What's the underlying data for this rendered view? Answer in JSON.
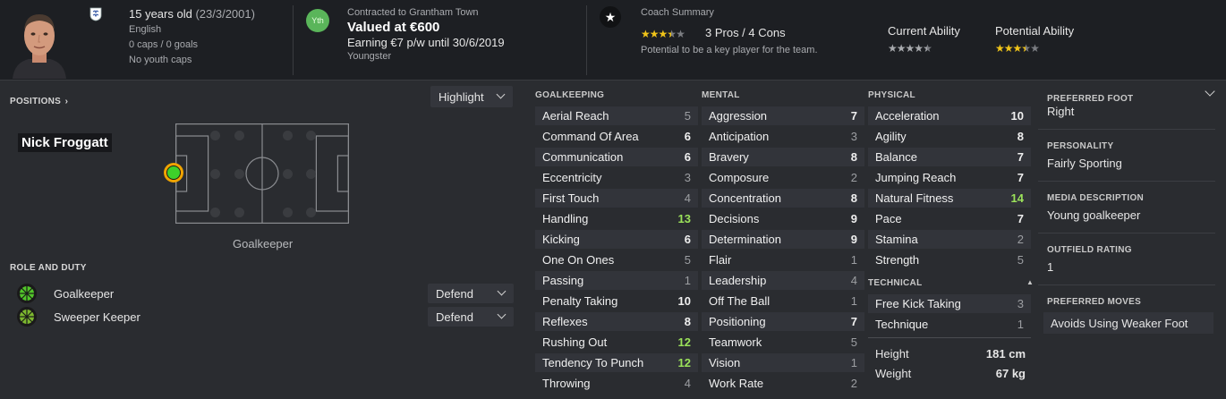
{
  "header": {
    "age": "15 years old",
    "dob": "(23/3/2001)",
    "nationality": "English",
    "caps": "0 caps / 0 goals",
    "youth_caps": "No youth caps",
    "status_badge": "Yth",
    "contract": "Contracted to Grantham Town",
    "value": "Valued at €600",
    "wage": "Earning €7 p/w until 30/6/2019",
    "status": "Youngster",
    "coach_title": "Coach Summary",
    "pros_cons": "3 Pros / 4 Cons",
    "coach_summary": "Potential to be a key player for the team.",
    "coach_stars": 3.5,
    "current_ability_label": "Current Ability",
    "current_ability_stars": 4.5,
    "potential_ability_label": "Potential Ability",
    "potential_ability_stars": 3.5
  },
  "positions": {
    "header": "POSITIONS",
    "highlight_label": "Highlight",
    "player_name": "Nick Froggatt",
    "position_label": "Goalkeeper"
  },
  "roles": {
    "header": "ROLE AND DUTY",
    "items": [
      {
        "name": "Goalkeeper",
        "duty": "Defend",
        "color": "#52c62a"
      },
      {
        "name": "Sweeper Keeper",
        "duty": "Defend",
        "color": "#7cb82f"
      }
    ]
  },
  "attributes": {
    "goalkeeping": {
      "header": "GOALKEEPING",
      "items": [
        {
          "name": "Aerial Reach",
          "value": "5"
        },
        {
          "name": "Command Of Area",
          "value": "6"
        },
        {
          "name": "Communication",
          "value": "6"
        },
        {
          "name": "Eccentricity",
          "value": "3"
        },
        {
          "name": "First Touch",
          "value": "4"
        },
        {
          "name": "Handling",
          "value": "13"
        },
        {
          "name": "Kicking",
          "value": "6"
        },
        {
          "name": "One On Ones",
          "value": "5"
        },
        {
          "name": "Passing",
          "value": "1"
        },
        {
          "name": "Penalty Taking",
          "value": "10"
        },
        {
          "name": "Reflexes",
          "value": "8"
        },
        {
          "name": "Rushing Out",
          "value": "12"
        },
        {
          "name": "Tendency To Punch",
          "value": "12"
        },
        {
          "name": "Throwing",
          "value": "4"
        }
      ]
    },
    "mental": {
      "header": "MENTAL",
      "items": [
        {
          "name": "Aggression",
          "value": "7"
        },
        {
          "name": "Anticipation",
          "value": "3"
        },
        {
          "name": "Bravery",
          "value": "8"
        },
        {
          "name": "Composure",
          "value": "2"
        },
        {
          "name": "Concentration",
          "value": "8"
        },
        {
          "name": "Decisions",
          "value": "9"
        },
        {
          "name": "Determination",
          "value": "9"
        },
        {
          "name": "Flair",
          "value": "1"
        },
        {
          "name": "Leadership",
          "value": "4"
        },
        {
          "name": "Off The Ball",
          "value": "1"
        },
        {
          "name": "Positioning",
          "value": "7"
        },
        {
          "name": "Teamwork",
          "value": "5"
        },
        {
          "name": "Vision",
          "value": "1"
        },
        {
          "name": "Work Rate",
          "value": "2"
        }
      ]
    },
    "physical": {
      "header": "PHYSICAL",
      "items": [
        {
          "name": "Acceleration",
          "value": "10"
        },
        {
          "name": "Agility",
          "value": "8"
        },
        {
          "name": "Balance",
          "value": "7"
        },
        {
          "name": "Jumping Reach",
          "value": "7"
        },
        {
          "name": "Natural Fitness",
          "value": "14"
        },
        {
          "name": "Pace",
          "value": "7"
        },
        {
          "name": "Stamina",
          "value": "2"
        },
        {
          "name": "Strength",
          "value": "5"
        }
      ]
    },
    "technical": {
      "header": "TECHNICAL",
      "items": [
        {
          "name": "Free Kick Taking",
          "value": "3"
        },
        {
          "name": "Technique",
          "value": "1"
        }
      ]
    },
    "body": {
      "height_label": "Height",
      "height": "181 cm",
      "weight_label": "Weight",
      "weight": "67 kg"
    }
  },
  "info": {
    "preferred_foot_label": "PREFERRED FOOT",
    "preferred_foot": "Right",
    "personality_label": "PERSONALITY",
    "personality": "Fairly Sporting",
    "media_label": "MEDIA DESCRIPTION",
    "media": "Young goalkeeper",
    "outfield_label": "OUTFIELD RATING",
    "outfield": "1",
    "moves_label": "PREFERRED MOVES",
    "moves": "Avoids Using Weaker Foot"
  },
  "colors": {
    "background": "#2a2c30",
    "header": "#1d1f23",
    "highlight_value": "#9be25a",
    "star": "#f0c419",
    "youth_badge": "#5ab55a"
  }
}
